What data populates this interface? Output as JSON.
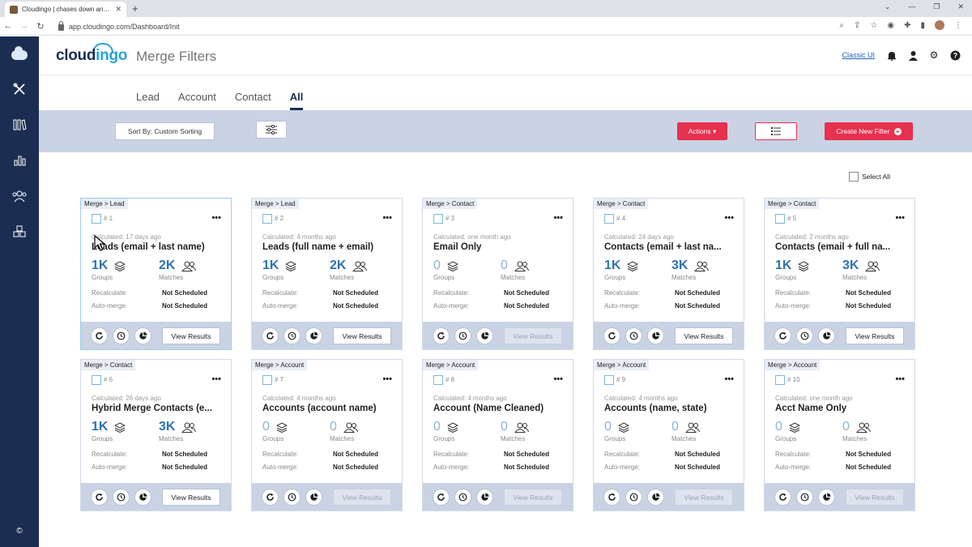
{
  "browser": {
    "tab_title": "Cloudingo | chases down and eli",
    "tab_close": "✕",
    "new_tab": "+",
    "url": "app.cloudingo.com/Dashboard/Init"
  },
  "header": {
    "logo_main": "cloud",
    "logo_accent": "ingo",
    "title": "Merge Filters",
    "classic_link": "Classic UI"
  },
  "sidebar": {
    "copyright": "©"
  },
  "tabs": [
    {
      "label": "Lead"
    },
    {
      "label": "Account"
    },
    {
      "label": "Contact"
    },
    {
      "label": "All",
      "active": true
    }
  ],
  "toolbar": {
    "sort_label": "Sort By: Custom Sorting",
    "actions_label": "Actions ▾",
    "create_label": "Create New Filter",
    "plus": "+"
  },
  "select_all": "Select All",
  "cards": [
    {
      "crumb": "Merge > Lead",
      "num": "# 1",
      "calc": "Calculated: 17 days ago",
      "title": "Leads (email + last name)",
      "groups": "1K",
      "matches": "2K",
      "groups_label": "Groups",
      "matches_label": "Matches",
      "recalc_label": "Recalculate:",
      "recalc": "Not Scheduled",
      "auto_label": "Auto-merge:",
      "auto": "Not Scheduled",
      "view": "View Results",
      "enabled": true
    },
    {
      "crumb": "Merge > Lead",
      "num": "# 2",
      "calc": "Calculated: 4 months ago",
      "title": "Leads (full name + email)",
      "groups": "1K",
      "matches": "2K",
      "groups_label": "Groups",
      "matches_label": "Matches",
      "recalc_label": "Recalculate:",
      "recalc": "Not Scheduled",
      "auto_label": "Auto-merge:",
      "auto": "Not Scheduled",
      "view": "View Results",
      "enabled": true
    },
    {
      "crumb": "Merge > Contact",
      "num": "# 3",
      "calc": "Calculated: one month ago",
      "title": "Email Only",
      "groups": "0",
      "matches": "0",
      "groups_label": "Groups",
      "matches_label": "Matches",
      "recalc_label": "Recalculate:",
      "recalc": "Not Scheduled",
      "auto_label": "Auto-merge:",
      "auto": "Not Scheduled",
      "view": "View Results",
      "enabled": false
    },
    {
      "crumb": "Merge > Contact",
      "num": "# 4",
      "calc": "Calculated: 24 days ago",
      "title": "Contacts (email + last na...",
      "groups": "1K",
      "matches": "3K",
      "groups_label": "Groups",
      "matches_label": "Matches",
      "recalc_label": "Recalculate:",
      "recalc": "Not Scheduled",
      "auto_label": "Auto-merge:",
      "auto": "Not Scheduled",
      "view": "View Results",
      "enabled": true
    },
    {
      "crumb": "Merge > Contact",
      "num": "# 5",
      "calc": "Calculated: 2 months ago",
      "title": "Contacts (email + full na...",
      "groups": "1K",
      "matches": "3K",
      "groups_label": "Groups",
      "matches_label": "Matches",
      "recalc_label": "Recalculate:",
      "recalc": "Not Scheduled",
      "auto_label": "Auto-merge:",
      "auto": "Not Scheduled",
      "view": "View Results",
      "enabled": true
    },
    {
      "crumb": "Merge > Contact",
      "num": "# 6",
      "calc": "Calculated: 26 days ago",
      "title": "Hybrid Merge Contacts (e...",
      "groups": "1K",
      "matches": "3K",
      "groups_label": "Groups",
      "matches_label": "Matches",
      "recalc_label": "Recalculate:",
      "recalc": "Not Scheduled",
      "auto_label": "Auto-merge:",
      "auto": "Not Scheduled",
      "view": "View Results",
      "enabled": true
    },
    {
      "crumb": "Merge > Account",
      "num": "# 7",
      "calc": "Calculated: 4 months ago",
      "title": "Accounts (account name)",
      "groups": "0",
      "matches": "0",
      "groups_label": "Groups",
      "matches_label": "Matches",
      "recalc_label": "Recalculate:",
      "recalc": "Not Scheduled",
      "auto_label": "Auto-merge:",
      "auto": "Not Scheduled",
      "view": "View Results",
      "enabled": false
    },
    {
      "crumb": "Merge > Account",
      "num": "# 8",
      "calc": "Calculated: 4 months ago",
      "title": "Account (Name Cleaned)",
      "groups": "0",
      "matches": "0",
      "groups_label": "Groups",
      "matches_label": "Matches",
      "recalc_label": "Recalculate:",
      "recalc": "Not Scheduled",
      "auto_label": "Auto-merge:",
      "auto": "Not Scheduled",
      "view": "View Results",
      "enabled": false
    },
    {
      "crumb": "Merge > Account",
      "num": "# 9",
      "calc": "Calculated: 4 months ago",
      "title": "Accounts (name, state)",
      "groups": "0",
      "matches": "0",
      "groups_label": "Groups",
      "matches_label": "Matches",
      "recalc_label": "Recalculate:",
      "recalc": "Not Scheduled",
      "auto_label": "Auto-merge:",
      "auto": "Not Scheduled",
      "view": "View Results",
      "enabled": false
    },
    {
      "crumb": "Merge > Account",
      "num": "# 10",
      "calc": "Calculated: one month ago",
      "title": "Acct Name Only",
      "groups": "0",
      "matches": "0",
      "groups_label": "Groups",
      "matches_label": "Matches",
      "recalc_label": "Recalculate:",
      "recalc": "Not Scheduled",
      "auto_label": "Auto-merge:",
      "auto": "Not Scheduled",
      "view": "View Results",
      "enabled": false
    }
  ],
  "colors": {
    "brand_navy": "#1b2e52",
    "accent_red": "#e8304f",
    "stat_blue": "#2f72b6",
    "band": "#c9d3e4"
  }
}
